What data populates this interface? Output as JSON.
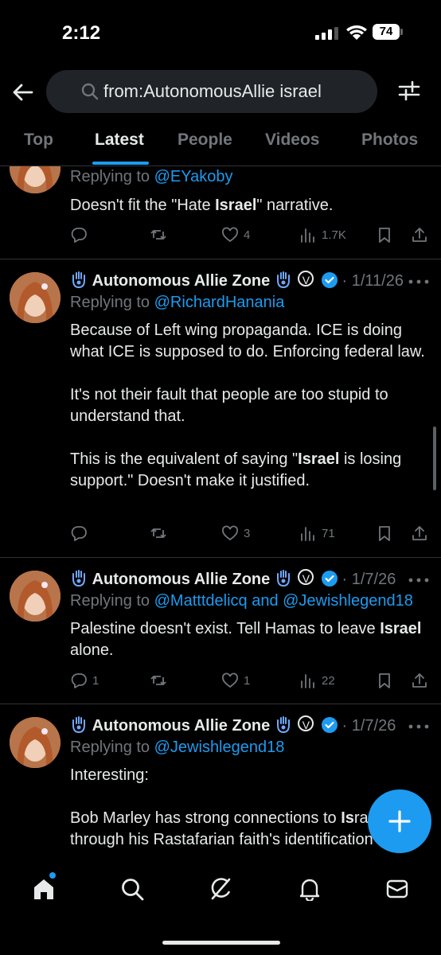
{
  "status_bar": {
    "time": "2:12",
    "battery": "74"
  },
  "search": {
    "query": "from:AutonomousAllie israel"
  },
  "tabs": [
    {
      "label": "Top"
    },
    {
      "label": "Latest"
    },
    {
      "label": "People"
    },
    {
      "label": "Videos"
    },
    {
      "label": "Photos"
    }
  ],
  "posts": [
    {
      "reply_prefix": "Replying to ",
      "reply_handles": "@EYakoby",
      "body_parts": [
        "Doesn't fit the \"Hate ",
        "Israel",
        "\" narrative."
      ],
      "likes": "4",
      "views": "1.7K",
      "replies": "",
      "reposts": ""
    },
    {
      "author": "Autonomous Allie Zone",
      "date": "1/11/26",
      "reply_prefix": "Replying to ",
      "reply_handles": "@RichardHanania",
      "p1": "Because of Left wing propaganda. ICE is doing what ICE is supposed to do. Enforcing federal law.",
      "p2": "It's not their fault that people are too stupid to understand that.",
      "p3_parts": [
        "This is the equivalent of saying \"",
        "Israel",
        " is losing support.\" Doesn't make it justified."
      ],
      "likes": "3",
      "views": "71"
    },
    {
      "author": "Autonomous Allie Zone",
      "date": "1/7/26",
      "reply_prefix": "Replying to ",
      "reply_handles": "@Matttdelicq and @Jewishlegend18",
      "body_parts": [
        "Palestine doesn't exist. Tell Hamas to leave ",
        "Israel",
        " alone."
      ],
      "replies": "1",
      "likes": "1",
      "views": "22"
    },
    {
      "author": "Autonomous Allie Zone",
      "date": "1/7/26",
      "reply_prefix": "Replying to ",
      "reply_handles": "@Jewishlegend18",
      "p1": "Interesting:",
      "p2_parts": [
        "Bob Marley has strong connections to ",
        "Is",
        "rael through his Rastafarian faith's identification with the biblical Israelites, his father's claimed"
      ]
    }
  ],
  "colors": {
    "accent": "#1d9bf0",
    "background": "#000000",
    "muted": "#71767b",
    "text": "#e7e9ea"
  },
  "icons": [
    "back-arrow-icon",
    "search-icon",
    "filter-icon",
    "reply-icon",
    "repost-icon",
    "like-icon",
    "views-icon",
    "bookmark-icon",
    "share-icon",
    "more-icon",
    "compose-icon",
    "home-icon",
    "grok-icon",
    "notifications-icon",
    "messages-icon"
  ]
}
